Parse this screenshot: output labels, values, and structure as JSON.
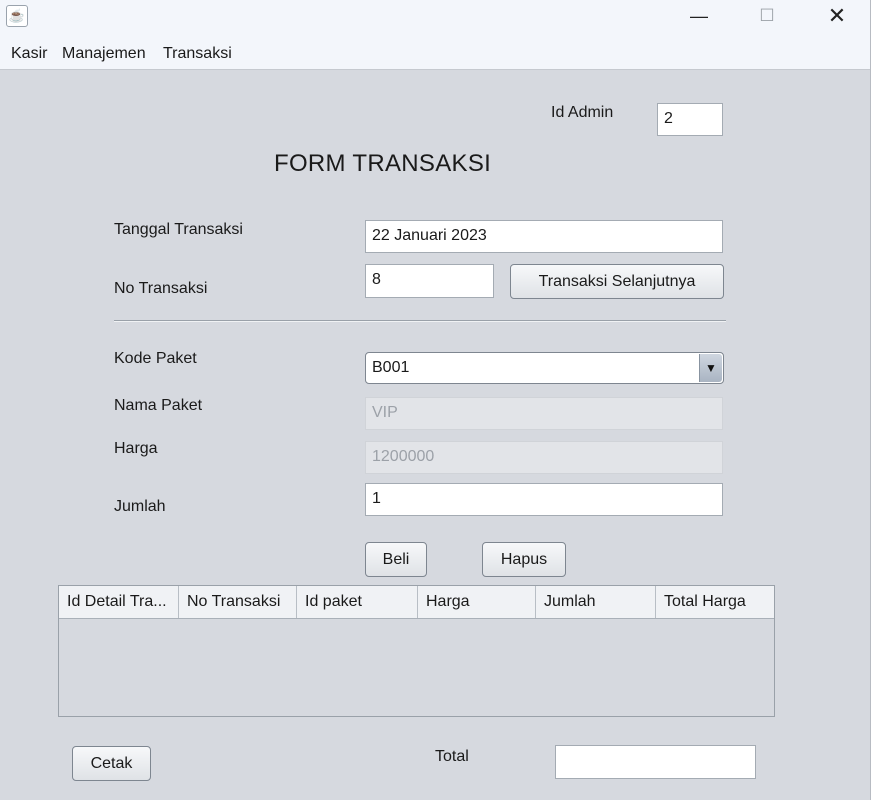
{
  "window": {
    "app_icon": "java-app-icon"
  },
  "menu": [
    "Kasir",
    "Manajemen",
    "Transaksi"
  ],
  "admin": {
    "label": "Id Admin",
    "value": "2"
  },
  "form_title": "FORM TRANSAKSI",
  "tanggal": {
    "label": "Tanggal Transaksi",
    "value": "22 Januari 2023"
  },
  "no_transaksi": {
    "label": "No Transaksi",
    "value": "8",
    "next_button": "Transaksi Selanjutnya"
  },
  "kode_paket": {
    "label": "Kode Paket",
    "value": "B001"
  },
  "nama_paket": {
    "label": "Nama Paket",
    "value": "VIP"
  },
  "harga": {
    "label": "Harga",
    "value": "1200000"
  },
  "jumlah": {
    "label": "Jumlah",
    "value": "1"
  },
  "buttons": {
    "beli": "Beli",
    "hapus": "Hapus",
    "cetak": "Cetak"
  },
  "table": {
    "columns": [
      "Id Detail Tra...",
      "No Transaksi",
      "Id paket",
      "Harga",
      "Jumlah",
      "Total Harga"
    ],
    "rows": []
  },
  "total": {
    "label": "Total",
    "value": ""
  }
}
